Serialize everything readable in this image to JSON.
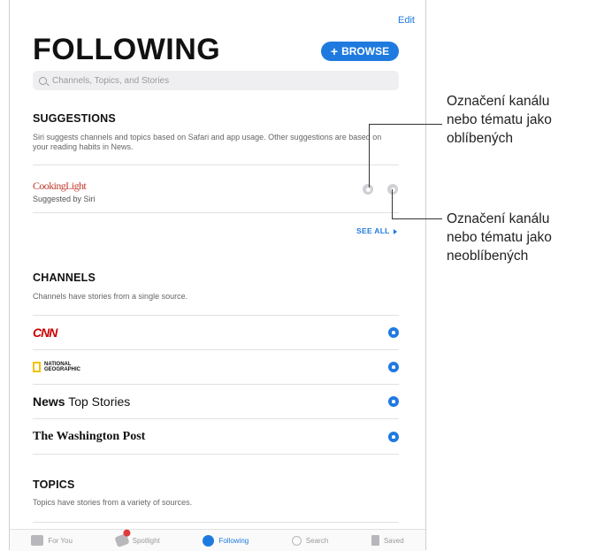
{
  "header": {
    "edit_label": "Edit",
    "title": "FOLLOWING",
    "browse_label": "BROWSE",
    "browse_plus": "+"
  },
  "search": {
    "placeholder": "Channels, Topics, and Stories"
  },
  "suggestions": {
    "heading": "SUGGESTIONS",
    "description": "Siri suggests channels and topics based on Safari and app usage. Other suggestions are based on your reading habits in News.",
    "item_name": "CookingLight",
    "item_sub": "Suggested by Siri",
    "see_all": "SEE ALL"
  },
  "channels": {
    "heading": "CHANNELS",
    "description": "Channels have stories from a single source.",
    "items": [
      {
        "label": "CNN"
      },
      {
        "label_line1": "NATIONAL",
        "label_line2": "GEOGRAPHIC"
      },
      {
        "label_bold": "News",
        "label_rest": " Top Stories"
      },
      {
        "label": "The Washington Post"
      }
    ]
  },
  "topics": {
    "heading": "TOPICS",
    "description": "Topics have stories from a variety of sources."
  },
  "tabbar": {
    "items": [
      {
        "label": "For You",
        "icon": "for-you-icon"
      },
      {
        "label": "Spotlight",
        "icon": "spotlight-icon"
      },
      {
        "label": "Following",
        "icon": "following-icon",
        "active": true
      },
      {
        "label": "Search",
        "icon": "search-icon"
      },
      {
        "label": "Saved",
        "icon": "saved-icon"
      }
    ]
  },
  "callouts": {
    "favorite": [
      "Označení kanálu",
      "nebo tématu jako",
      "oblíbených"
    ],
    "unfavorite": [
      "Označení kanálu",
      "nebo tématu jako",
      "neoblíbených"
    ]
  },
  "colors": {
    "accent": "#1f7ae0",
    "cnn_red": "#cc0000",
    "cooking_red": "#c0392b",
    "natgeo_yellow": "#f2c200"
  }
}
